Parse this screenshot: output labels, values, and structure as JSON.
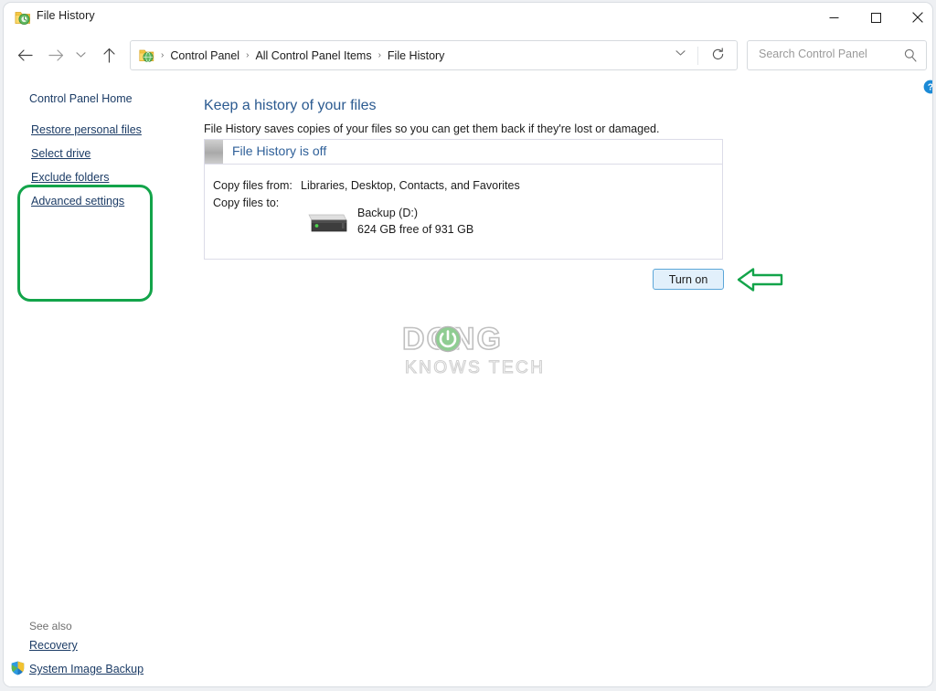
{
  "window": {
    "title": "File History",
    "icon": "file-history-icon",
    "controls": {
      "minimize": "Minimize",
      "maximize": "Maximize",
      "close": "Close"
    }
  },
  "toolbar": {
    "back": "Back",
    "forward": "Forward",
    "recent": "Recent locations",
    "up": "Up",
    "refresh": "Refresh",
    "address": {
      "icon": "control-panel-icon",
      "crumbs": [
        "Control Panel",
        "All Control Panel Items",
        "File History"
      ],
      "separator": "›",
      "dropdown": "Previous locations"
    },
    "search": {
      "placeholder": "Search Control Panel",
      "value": "",
      "icon": "search-icon"
    }
  },
  "sidebar": {
    "home_label": "Control Panel Home",
    "items": [
      {
        "label": "Restore personal files"
      },
      {
        "label": "Select drive"
      },
      {
        "label": "Exclude folders"
      },
      {
        "label": "Advanced settings"
      }
    ],
    "see_also_label": "See also",
    "see_also": [
      {
        "label": "Recovery",
        "icon": ""
      },
      {
        "label": "System Image Backup",
        "icon": "shield-icon"
      }
    ]
  },
  "main": {
    "title": "Keep a history of your files",
    "description": "File History saves copies of your files so you can get them back if they're lost or damaged.",
    "help_icon": "help-icon",
    "status": {
      "glyph": "file-history-status-icon",
      "text": "File History is off",
      "rows": [
        {
          "label": "Copy files from:",
          "value": "Libraries, Desktop, Contacts, and Favorites"
        },
        {
          "label": "Copy files to:",
          "value": ""
        }
      ],
      "drive": {
        "icon": "external-hard-drive-icon",
        "name": "Backup (D:)",
        "free": "624 GB free of 931 GB"
      }
    },
    "turn_on_label": "Turn on"
  },
  "annotations": {
    "box_color": "#13a44a",
    "arrow_color": "#13a44a",
    "arrow_direction": "left",
    "box_target": "sidebar-links",
    "arrow_target": "turn-on-button"
  },
  "watermark": {
    "line1": "DONG",
    "line2": "KNOWS TECH",
    "accent_color": "#4caf50"
  },
  "colors": {
    "heading_blue": "#2b5a90",
    "link_blue": "#1c3c66",
    "status_blue": "#2f6099",
    "accent_green": "#13a44a",
    "button_fill": "#e2f0fb",
    "button_border": "#5ba6d8",
    "help_blue": "#1b8ad6"
  }
}
